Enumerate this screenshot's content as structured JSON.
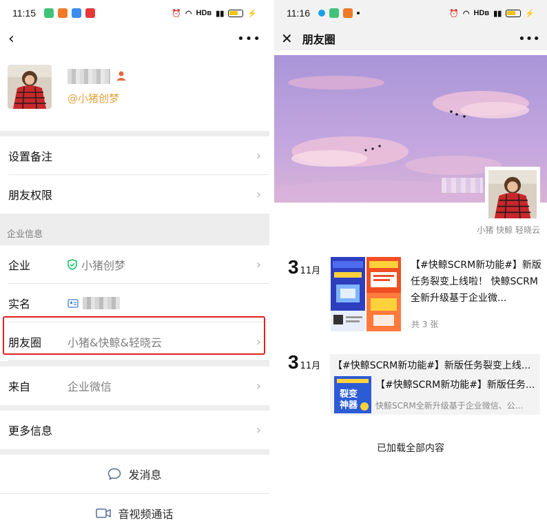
{
  "left": {
    "status": {
      "time": "11:15",
      "net": "HDʙ"
    },
    "profile": {
      "corp_name": "@小猪创梦"
    },
    "rows": [
      {
        "label": "设置备注",
        "value": ""
      },
      {
        "label": "朋友权限",
        "value": ""
      }
    ],
    "section_title": "企业信息",
    "info_rows": [
      {
        "label": "企业",
        "value": "小猪创梦"
      },
      {
        "label": "实名",
        "value": ""
      },
      {
        "label": "朋友圈",
        "value": "小猪&快鲸&轻晓云"
      },
      {
        "label": "来自",
        "value": "企业微信"
      }
    ],
    "more_info": "更多信息",
    "actions": {
      "send_message": "发消息",
      "video_call": "音视频通话"
    }
  },
  "right": {
    "status": {
      "time": "11:16",
      "net": "HDʙ"
    },
    "title": "朋友圈",
    "cover_names": "小猪 快鲸 轻晓云",
    "posts": [
      {
        "day": "3",
        "month": "11月",
        "text": "【#快鲸SCRM新功能#】新版任务裂变上线啦！ 快鲸SCRM全新升级基于企业微...",
        "count": "共 3 张"
      },
      {
        "day": "3",
        "month": "11月",
        "share_title": "【#快鲸SCRM新功能#】新版任务裂变上线...",
        "share_line1": "【#快鲸SCRM新功能#】新版任务...",
        "share_line2": "快鲸SCRM全新升级基于企业微信、公..."
      }
    ],
    "loaded": "已加载全部内容"
  },
  "colors": {
    "accent_orange": "#e6a23c",
    "highlight_red": "#e02020",
    "wechat_green": "#07c160"
  }
}
